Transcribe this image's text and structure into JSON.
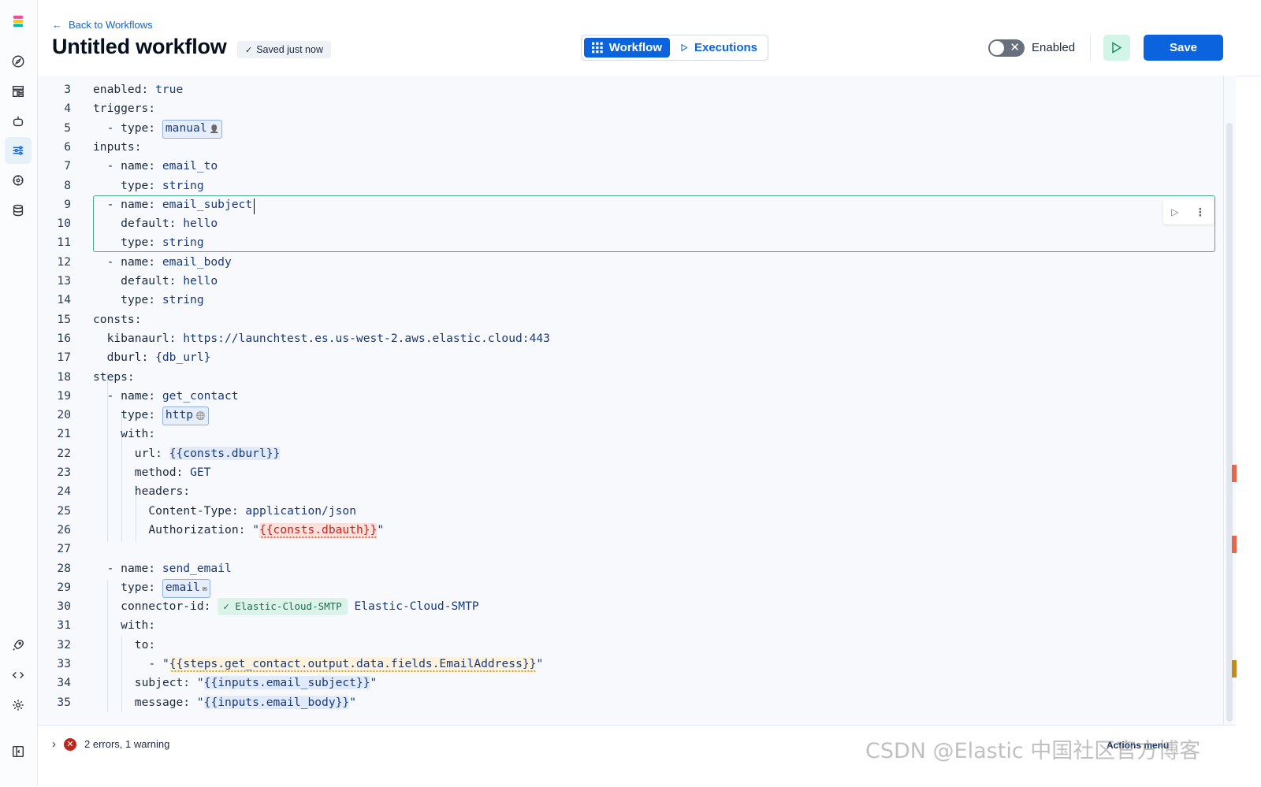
{
  "header": {
    "back_label": "Back to Workflows",
    "title": "Untitled workflow",
    "saved_status": "Saved just now",
    "tabs": [
      {
        "label": "Workflow",
        "active": true
      },
      {
        "label": "Executions",
        "active": false
      }
    ],
    "toggle_label": "Enabled",
    "toggle_on": false,
    "save_label": "Save"
  },
  "editor": {
    "lines": [
      {
        "n": "3",
        "indent": 0,
        "key": "enabled:",
        "value": " true"
      },
      {
        "n": "4",
        "indent": 0,
        "key": "triggers:"
      },
      {
        "n": "5",
        "indent": 1,
        "key": "- type: ",
        "pill": "manual",
        "pill_icon": "user-icon"
      },
      {
        "n": "6",
        "indent": 0,
        "key": "inputs:"
      },
      {
        "n": "7",
        "indent": 1,
        "key": "- name:",
        "value": " email_to"
      },
      {
        "n": "8",
        "indent": 1,
        "key": "  type:",
        "value": " string"
      },
      {
        "n": "9",
        "indent": 1,
        "key": "- name:",
        "value": " email_subject"
      },
      {
        "n": "10",
        "indent": 1,
        "key": "  default:",
        "value": " hello"
      },
      {
        "n": "11",
        "indent": 1,
        "key": "  type:",
        "value": " string"
      },
      {
        "n": "12",
        "indent": 1,
        "key": "- name:",
        "value": " email_body"
      },
      {
        "n": "13",
        "indent": 1,
        "key": "  default:",
        "value": " hello"
      },
      {
        "n": "14",
        "indent": 1,
        "key": "  type:",
        "value": " string"
      },
      {
        "n": "15",
        "indent": 0,
        "key": "consts:"
      },
      {
        "n": "16",
        "indent": 1,
        "key": "kibanaurl:",
        "value": " https://launchtest.es.us-west-2.aws.elastic.cloud:443"
      },
      {
        "n": "17",
        "indent": 1,
        "key": "dburl:",
        "value": " {db_url}"
      },
      {
        "n": "18",
        "indent": 0,
        "key": "steps:"
      },
      {
        "n": "19",
        "indent": 1,
        "key": "- name:",
        "value": " get_contact"
      },
      {
        "n": "20",
        "indent": 1,
        "key": "  type: ",
        "pill": "http",
        "pill_icon": "globe-icon"
      },
      {
        "n": "21",
        "indent": 1,
        "key": "  with:"
      },
      {
        "n": "22",
        "indent": 3,
        "key": "url: ",
        "tmpl": "{{consts.dburl}}",
        "tmpl_style": "tmpl"
      },
      {
        "n": "23",
        "indent": 3,
        "key": "method:",
        "value": " GET"
      },
      {
        "n": "24",
        "indent": 3,
        "key": "headers:"
      },
      {
        "n": "25",
        "indent": 4,
        "key": "Content-Type:",
        "value": " application/json"
      },
      {
        "n": "26",
        "indent": 4,
        "key": "Authorization: ",
        "quoted": true,
        "tmpl": "{{consts.dbauth}}",
        "tmpl_style": "tmpl-err"
      },
      {
        "n": "27",
        "indent": 0,
        "key": ""
      },
      {
        "n": "28",
        "indent": 1,
        "key": "- name:",
        "value": " send_email"
      },
      {
        "n": "29",
        "indent": 1,
        "key": "  type: ",
        "pill": "email",
        "pill_icon": "mail-icon"
      },
      {
        "n": "30",
        "indent": 1,
        "key": "  connector-id: ",
        "badge": "✓ Elastic-Cloud-SMTP",
        "value": " Elastic-Cloud-SMTP"
      },
      {
        "n": "31",
        "indent": 1,
        "key": "  with:"
      },
      {
        "n": "32",
        "indent": 3,
        "key": "to:"
      },
      {
        "n": "33",
        "indent": 4,
        "key": "- ",
        "quoted": true,
        "tmpl": "{{steps.get_contact.output.data.fields.EmailAddress}}",
        "tmpl_style": "tmpl-warn"
      },
      {
        "n": "34",
        "indent": 3,
        "key": "subject: ",
        "quoted": true,
        "tmpl": "{{inputs.email_subject}}",
        "tmpl_style": "tmpl"
      },
      {
        "n": "35",
        "indent": 3,
        "key": "message: ",
        "quoted": true,
        "tmpl": "{{inputs.email_body}}",
        "tmpl_style": "tmpl"
      }
    ]
  },
  "footer": {
    "status": "2 errors, 1 warning",
    "actions_menu": "Actions menu",
    "watermark": "CSDN @Elastic 中国社区官方博客"
  },
  "colors": {
    "accent": "#0b64dd",
    "error": "#bd271e",
    "success_bg": "#d3f5e8"
  }
}
